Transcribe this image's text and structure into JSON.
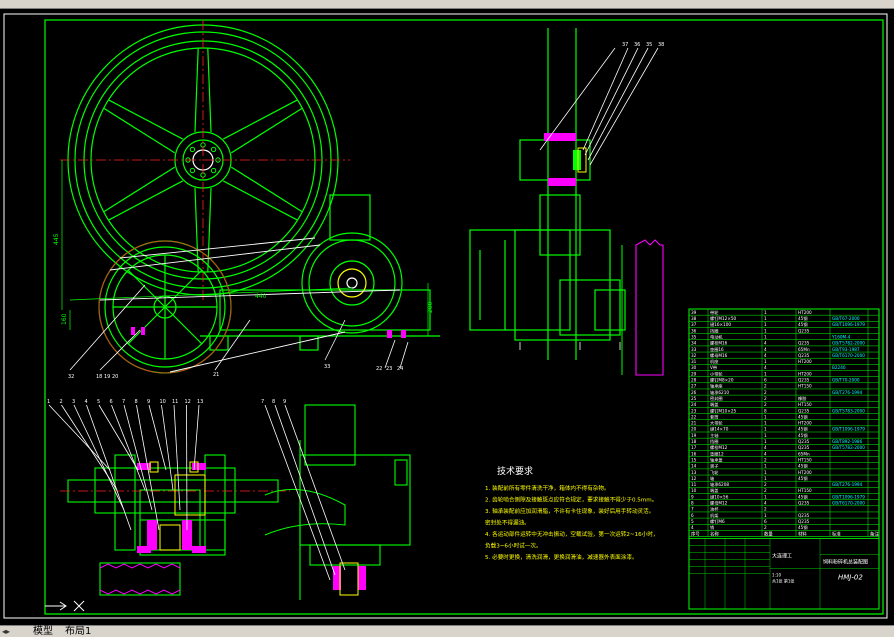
{
  "tabs": {
    "model": "模型",
    "layout1": "布局1"
  },
  "tech": {
    "title": "技术要求",
    "lines": [
      "1. 装配前所有零件清洗干净，箱体内不得有杂物。",
      "2. 齿轮啮合侧隙及接触斑点应符合规定，要求接触不得少于0.5mm。",
      "3. 轴承装配前应加润滑脂，不许有卡住现象，装好后用手转动灵活。",
      "   密封处不得漏油。",
      "4. 各运动部件运转中无冲击振动，空载试验，第一次运转2~16小时，",
      "   负载3~6小时试一次。",
      "5. 必要时更换，清洗润滑，更换润滑油，减速器外表面涂漆。"
    ]
  },
  "balloons": {
    "top_right": [
      "37",
      "36",
      "35",
      "38"
    ],
    "bottom_left": [
      "1",
      "2",
      "3",
      "4",
      "5",
      "6",
      "7",
      "8",
      "9",
      "10",
      "11",
      "12",
      "13"
    ],
    "bottom_mid": [
      "7",
      "8",
      "9"
    ],
    "main_view": [
      "32",
      "18",
      "19",
      "20",
      "21",
      "33",
      "22",
      "23",
      "24"
    ]
  },
  "dims": [
    "445",
    "440",
    "160",
    "200"
  ],
  "bom": {
    "rows": [
      [
        "39",
        "带轮",
        "1",
        "HT200",
        "",
        ""
      ],
      [
        "38",
        "螺钉M12×50",
        "1",
        "45钢",
        "GB/T67-2000",
        ""
      ],
      [
        "37",
        "键16×100",
        "1",
        "45钢",
        "GB/T1096-1979",
        ""
      ],
      [
        "36",
        "挡圈",
        "1",
        "Q235",
        "",
        ""
      ],
      [
        "35",
        "电动机",
        "1",
        "",
        "Y160M-4",
        ""
      ],
      [
        "34",
        "螺栓M16",
        "4",
        "Q235",
        "GB/T5782-2000",
        ""
      ],
      [
        "33",
        "垫圈16",
        "4",
        "65Mn",
        "GB/T93-1987",
        ""
      ],
      [
        "32",
        "螺母M16",
        "4",
        "Q235",
        "GB/T6170-2000",
        ""
      ],
      [
        "31",
        "机座",
        "1",
        "HT200",
        "",
        ""
      ],
      [
        "30",
        "V带",
        "4",
        "",
        "B2240",
        ""
      ],
      [
        "29",
        "小带轮",
        "1",
        "HT200",
        "",
        ""
      ],
      [
        "28",
        "螺钉M8×20",
        "6",
        "Q235",
        "GB/T70-2000",
        ""
      ],
      [
        "27",
        "轴承座",
        "2",
        "HT150",
        "",
        ""
      ],
      [
        "26",
        "轴承6210",
        "2",
        "",
        "GB/T276-1994",
        ""
      ],
      [
        "25",
        "密封圈",
        "2",
        "橡胶",
        "",
        ""
      ],
      [
        "24",
        "端盖",
        "2",
        "HT150",
        "",
        ""
      ],
      [
        "23",
        "螺钉M10×25",
        "8",
        "Q235",
        "GB/T5783-2000",
        ""
      ],
      [
        "22",
        "套筒",
        "1",
        "45钢",
        "",
        ""
      ],
      [
        "21",
        "大带轮",
        "1",
        "HT200",
        "",
        ""
      ],
      [
        "20",
        "键14×70",
        "1",
        "45钢",
        "GB/T1096-1979",
        ""
      ],
      [
        "19",
        "主轴",
        "1",
        "45钢",
        "",
        ""
      ],
      [
        "18",
        "挡圈",
        "1",
        "Q235",
        "GB/T892-1986",
        ""
      ],
      [
        "17",
        "螺栓M12",
        "4",
        "Q235",
        "GB/T5782-2000",
        ""
      ],
      [
        "16",
        "垫圈12",
        "4",
        "65Mn",
        "",
        ""
      ],
      [
        "15",
        "轴承盖",
        "2",
        "HT150",
        "",
        ""
      ],
      [
        "14",
        "滚子",
        "1",
        "45钢",
        "",
        ""
      ],
      [
        "13",
        "飞轮",
        "1",
        "HT200",
        "",
        ""
      ],
      [
        "12",
        "轴",
        "1",
        "45钢",
        "",
        ""
      ],
      [
        "11",
        "轴承6208",
        "2",
        "",
        "GB/T276-1994",
        ""
      ],
      [
        "10",
        "端盖",
        "2",
        "HT150",
        "",
        ""
      ],
      [
        "9",
        "键10×56",
        "1",
        "45钢",
        "GB/T1096-1979",
        ""
      ],
      [
        "8",
        "螺母M12",
        "4",
        "Q235",
        "GB/T6170-2000",
        ""
      ],
      [
        "7",
        "油杯",
        "2",
        "",
        "",
        ""
      ],
      [
        "6",
        "机架",
        "1",
        "Q235",
        "",
        ""
      ],
      [
        "5",
        "螺钉M6",
        "6",
        "Q235",
        "",
        ""
      ],
      [
        "4",
        "销",
        "2",
        "45钢",
        "",
        ""
      ]
    ],
    "header": [
      "序号",
      "名称",
      "数量",
      "材料",
      "标准",
      "备注"
    ],
    "title_block": {
      "company": "大连理工",
      "drawing_name": "饲料粉碎机总装配图",
      "drawing_no": "HMJ-02",
      "scale": "1:10",
      "sheet": "共1张 第1张"
    }
  },
  "colors": {
    "green": "#00ff00",
    "white": "#ffffff",
    "red": "#ff2020",
    "magenta": "#ff00ff",
    "yellow": "#ffff00",
    "cyan": "#00ffff"
  }
}
